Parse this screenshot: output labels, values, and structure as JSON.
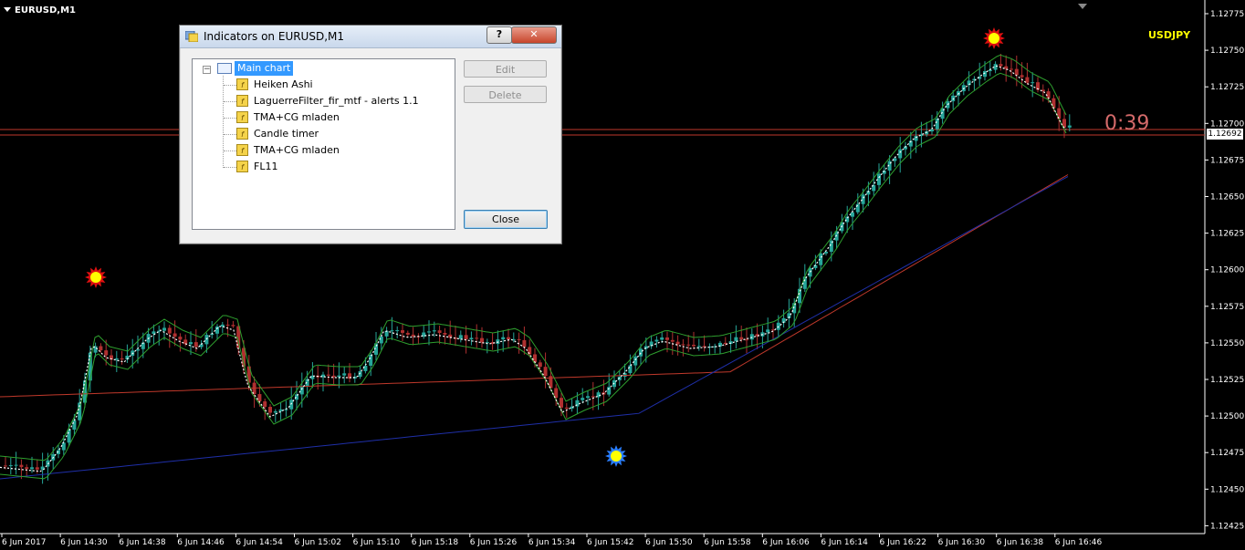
{
  "chart": {
    "title": "EURUSD,M1",
    "symbol_label": "USDJPY",
    "timer": "0:39",
    "current_price": "1.12692",
    "colors": {
      "background": "#000000",
      "bull": "#26a69a",
      "bear": "#b03030",
      "ma_red": "#c0392b",
      "ma_blue": "#1f2fa8",
      "band_green": "#2e9e2e",
      "dotted": "#ffffff",
      "text": "#ffffff",
      "symbol": "#ffff00",
      "timer": "#d46a6a"
    }
  },
  "price_axis": {
    "labels": [
      "1.12775",
      "1.12750",
      "1.12725",
      "1.12700",
      "1.12675",
      "1.12650",
      "1.12625",
      "1.12600",
      "1.12575",
      "1.12550",
      "1.12525",
      "1.12500",
      "1.12475",
      "1.12450",
      "1.12425"
    ]
  },
  "time_axis": {
    "labels": [
      "6 Jun 2017",
      "6 Jun 14:30",
      "6 Jun 14:38",
      "6 Jun 14:46",
      "6 Jun 14:54",
      "6 Jun 15:02",
      "6 Jun 15:10",
      "6 Jun 15:18",
      "6 Jun 15:26",
      "6 Jun 15:34",
      "6 Jun 15:42",
      "6 Jun 15:50",
      "6 Jun 15:58",
      "6 Jun 16:06",
      "6 Jun 16:14",
      "6 Jun 16:22",
      "6 Jun 16:30",
      "6 Jun 16:38",
      "6 Jun 16:46"
    ]
  },
  "dialog": {
    "title": "Indicators on EURUSD,M1",
    "help_label": "?",
    "close_x_label": "✕",
    "root_label": "Main chart",
    "indicators": [
      "Heiken Ashi",
      "LaguerreFilter_fir_mtf - alerts 1.1",
      "TMA+CG mladen",
      "Candle timer",
      "TMA+CG mladen",
      "FL11"
    ],
    "edit_label": "Edit",
    "delete_label": "Delete",
    "close_label": "Close"
  }
}
